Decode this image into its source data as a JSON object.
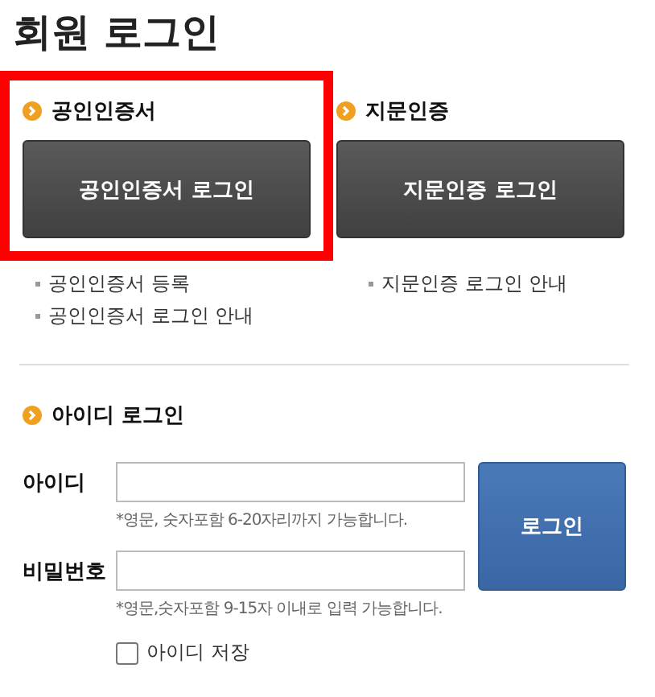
{
  "title": "회원 로그인",
  "cert_sections": [
    {
      "heading": "공인인증서",
      "button": "공인인증서 로그인",
      "highlighted": true,
      "links": [
        "공인인증서 등록",
        "공인인증서 로그인 안내"
      ]
    },
    {
      "heading": "지문인증",
      "button": "지문인증 로그인",
      "highlighted": false,
      "links": [
        "지문인증 로그인 안내"
      ]
    }
  ],
  "id_login": {
    "heading": "아이디 로그인",
    "fields": [
      {
        "label": "아이디",
        "hint": "*영문, 숫자포함 6-20자리까지 가능합니다."
      },
      {
        "label": "비밀번호",
        "hint": "*영문,숫자포함 9-15자 이내로 입력 가능합니다."
      }
    ],
    "login_button": "로그인",
    "remember": {
      "label": "아이디 저장",
      "checked": false
    }
  }
}
